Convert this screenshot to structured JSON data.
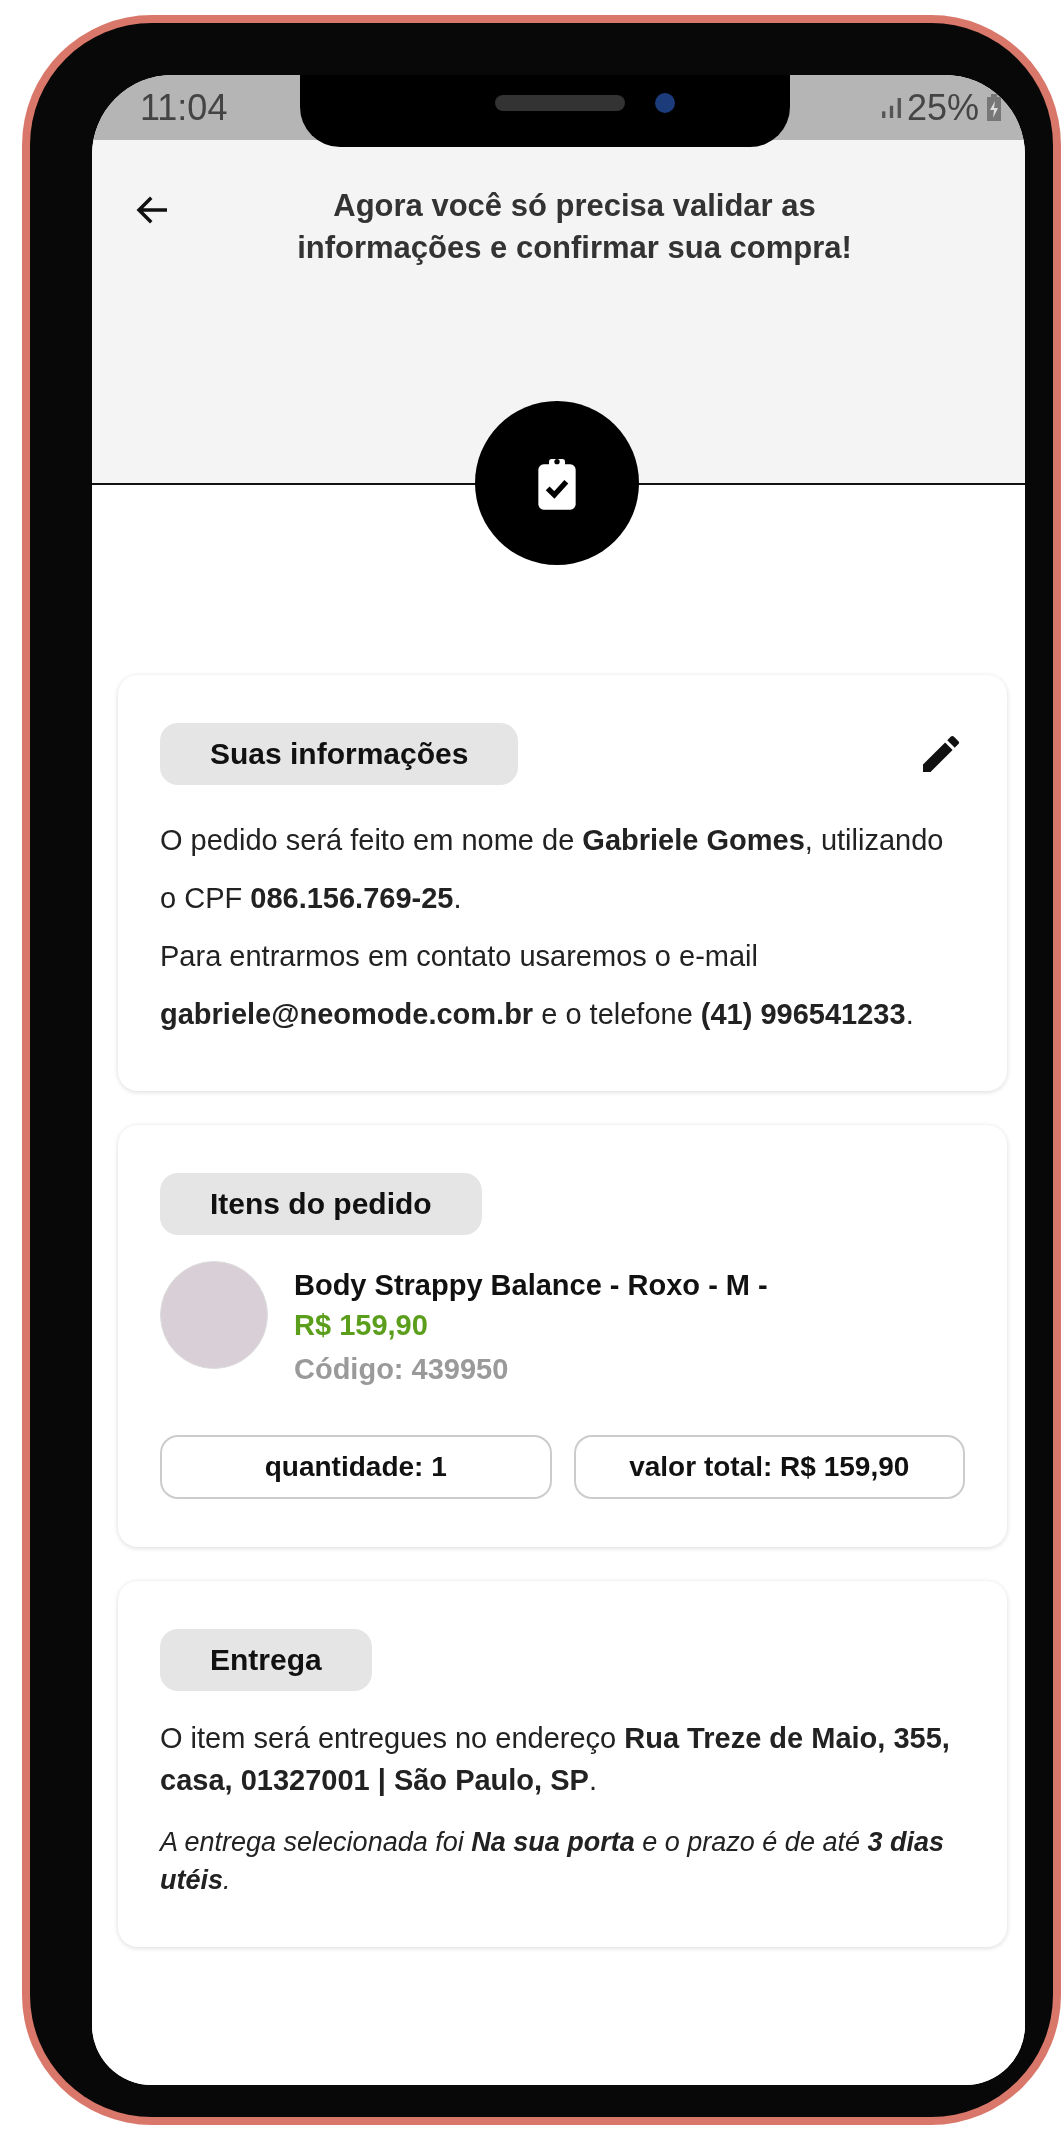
{
  "status_bar": {
    "time": "11:04",
    "battery": "25%"
  },
  "header": {
    "title": "Agora você só precisa validar as informações e confirmar sua compra!"
  },
  "sections": [
    {
      "kind": "info",
      "title": "Suas informações",
      "paragraphs": [
        "O pedido será feito em nome de **Gabriele Gomes**, utilizando o CPF **086.156.769-25**.",
        "Para entrarmos em contato usaremos o e-mail **gabriele@neomode.com.br** e o telefone **(41) 996541233**."
      ]
    },
    {
      "kind": "items",
      "title": "Itens do pedido",
      "products": [
        {
          "name": "Body Strappy Balance - Roxo - M -",
          "price": "R$ 159,90",
          "code": "Código: 439950"
        }
      ],
      "quantity": "quantidade: 1",
      "total": "valor total: R$ 159,90"
    },
    {
      "kind": "delivery",
      "title": "Entrega",
      "paragraphs": [
        "O item será entregues no endereço **Rua Treze de Maio, 355, casa, 01327001 | São Paulo, SP**."
      ],
      "note": "A entrega selecionada foi **Na sua porta** e o prazo é de até **3 dias utéis**."
    }
  ]
}
